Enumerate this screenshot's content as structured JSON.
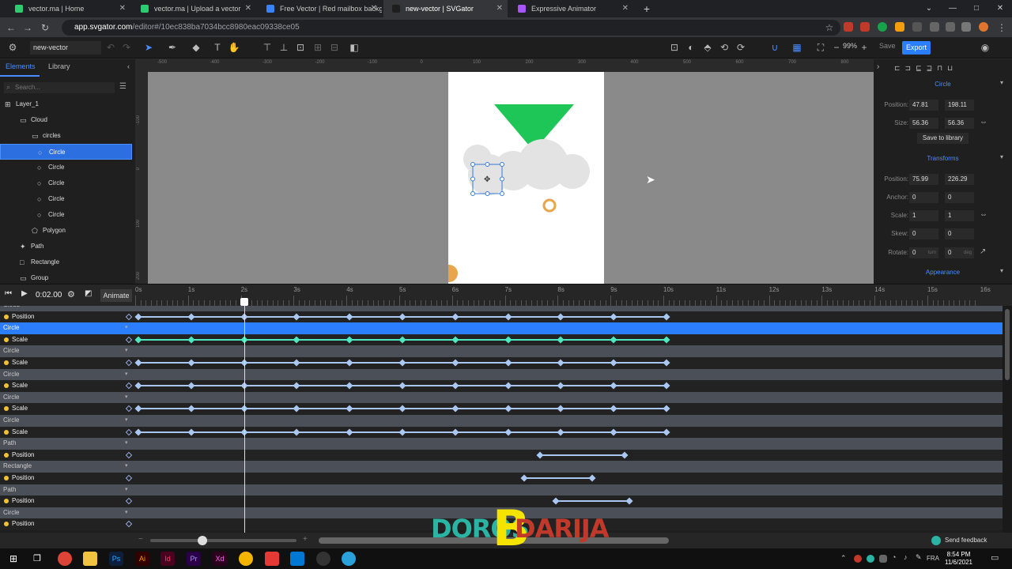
{
  "browser": {
    "tabs": [
      {
        "title": "vector.ma | Home",
        "color": "#2ecc71"
      },
      {
        "title": "vector.ma | Upload a vector",
        "color": "#2ecc71"
      },
      {
        "title": "Free Vector | Red mailbox backg",
        "color": "#3b82f6"
      },
      {
        "title": "new-vector | SVGator",
        "color": "#1e1e1e",
        "active": true
      },
      {
        "title": "Expressive Animator",
        "color": "#a855f7"
      }
    ],
    "url_host": "app.svgator.com",
    "url_path": "/editor#/10ec838ba7034bcc8980eac09338ce05"
  },
  "toolbar": {
    "project_name": "new-vector",
    "zoom": "99%",
    "save_label": "Save",
    "export_label": "Export"
  },
  "left_panel": {
    "tab_elements": "Elements",
    "tab_library": "Library",
    "search_placeholder": "Search...",
    "tree": [
      {
        "label": "Layer_1",
        "depth": 0,
        "icon": "layer-icon"
      },
      {
        "label": "Cloud",
        "depth": 1,
        "icon": "folder-icon"
      },
      {
        "label": "circles",
        "depth": 2,
        "icon": "folder-icon"
      },
      {
        "label": "Circle",
        "depth": 3,
        "icon": "circle-icon",
        "selected": true
      },
      {
        "label": "Circle",
        "depth": 3,
        "icon": "circle-icon"
      },
      {
        "label": "Circle",
        "depth": 3,
        "icon": "circle-icon"
      },
      {
        "label": "Circle",
        "depth": 3,
        "icon": "circle-icon"
      },
      {
        "label": "Circle",
        "depth": 3,
        "icon": "circle-icon"
      },
      {
        "label": "Polygon",
        "depth": 2,
        "icon": "polygon-icon"
      },
      {
        "label": "Path",
        "depth": 1,
        "icon": "path-icon"
      },
      {
        "label": "Rectangle",
        "depth": 1,
        "icon": "rect-icon"
      },
      {
        "label": "Group",
        "depth": 1,
        "icon": "folder-icon"
      }
    ]
  },
  "rulers": {
    "top": [
      "-500",
      "-400",
      "-300",
      "-200",
      "-100",
      "0",
      "100",
      "200",
      "300",
      "400",
      "500",
      "600",
      "700",
      "800",
      "900"
    ],
    "left": [
      "-100",
      "0",
      "100",
      "200"
    ]
  },
  "canvas": {
    "colors": {
      "triangle": "#1dc657",
      "cloud": "#e3e3e3",
      "ring": "#e8a54b",
      "ball": "#e8a54b",
      "selection": "#3a7bd5"
    }
  },
  "right_panel": {
    "section_circle": "Circle",
    "position_label": "Position:",
    "position_x": "47.81",
    "position_y": "198.11",
    "size_label": "Size:",
    "size_w": "56.36",
    "size_h": "56.36",
    "save_to_library": "Save to library",
    "section_transforms": "Transforms",
    "t_position_label": "Position:",
    "t_position_x": "75.99",
    "t_position_y": "226.29",
    "anchor_label": "Anchor:",
    "anchor_x": "0",
    "anchor_y": "0",
    "scale_label": "Scale:",
    "scale_x": "1",
    "scale_y": "1",
    "skew_label": "Skew:",
    "skew_x": "0",
    "skew_y": "0",
    "rotate_label": "Rotate:",
    "rotate_v": "0",
    "rotate_unit": "turn",
    "rotate_v2": "0",
    "rotate_unit2": "deg",
    "section_appearance": "Appearance"
  },
  "timeline": {
    "time": "0:02.00",
    "animate_label": "Animate",
    "seconds": [
      "0s",
      "1s",
      "2s",
      "3s",
      "4s",
      "5s",
      "6s",
      "7s",
      "8s",
      "9s",
      "10s",
      "11s",
      "12s",
      "13s",
      "14s",
      "15s",
      "16s"
    ],
    "rows": [
      {
        "type": "group",
        "label": "Cloud"
      },
      {
        "type": "prop",
        "label": "Position",
        "keys": [
          0,
          1,
          2,
          3,
          4,
          5,
          6,
          7,
          8,
          9,
          10
        ]
      },
      {
        "type": "group",
        "label": "Circle",
        "selected": true
      },
      {
        "type": "prop",
        "label": "Scale",
        "keys": [
          0,
          1,
          2,
          3,
          4,
          5,
          6,
          7,
          8,
          9,
          10
        ],
        "highlight": true
      },
      {
        "type": "group",
        "label": "Circle"
      },
      {
        "type": "prop",
        "label": "Scale",
        "keys": [
          0,
          1,
          2,
          3,
          4,
          5,
          6,
          7,
          8,
          9,
          10
        ]
      },
      {
        "type": "group",
        "label": "Circle"
      },
      {
        "type": "prop",
        "label": "Scale",
        "keys": [
          0,
          1,
          2,
          3,
          4,
          5,
          6,
          7,
          8,
          9,
          10
        ]
      },
      {
        "type": "group",
        "label": "Circle"
      },
      {
        "type": "prop",
        "label": "Scale",
        "keys": [
          0,
          1,
          2,
          3,
          4,
          5,
          6,
          7,
          8,
          9,
          10
        ]
      },
      {
        "type": "group",
        "label": "Circle"
      },
      {
        "type": "prop",
        "label": "Scale",
        "keys": [
          0,
          1,
          2,
          3,
          4,
          5,
          6,
          7,
          8,
          9,
          10
        ]
      },
      {
        "type": "group",
        "label": "Path"
      },
      {
        "type": "prop",
        "label": "Position",
        "keys": [
          7.6,
          9.2
        ]
      },
      {
        "type": "group",
        "label": "Rectangle"
      },
      {
        "type": "prop",
        "label": "Position",
        "keys": [
          7.3,
          8.6
        ]
      },
      {
        "type": "group",
        "label": "Path"
      },
      {
        "type": "prop",
        "label": "Position",
        "keys": [
          7.9,
          9.3
        ]
      },
      {
        "type": "group",
        "label": "Circle"
      },
      {
        "type": "prop",
        "label": "Position",
        "keys": []
      }
    ],
    "send_feedback": "Send feedback"
  },
  "taskbar": {
    "time": "8:54 PM",
    "date": "11/6/2021",
    "lang": "FRA"
  },
  "watermark": {
    "left": "DOROS",
    "mid": "B",
    "right": "DARIJA"
  }
}
